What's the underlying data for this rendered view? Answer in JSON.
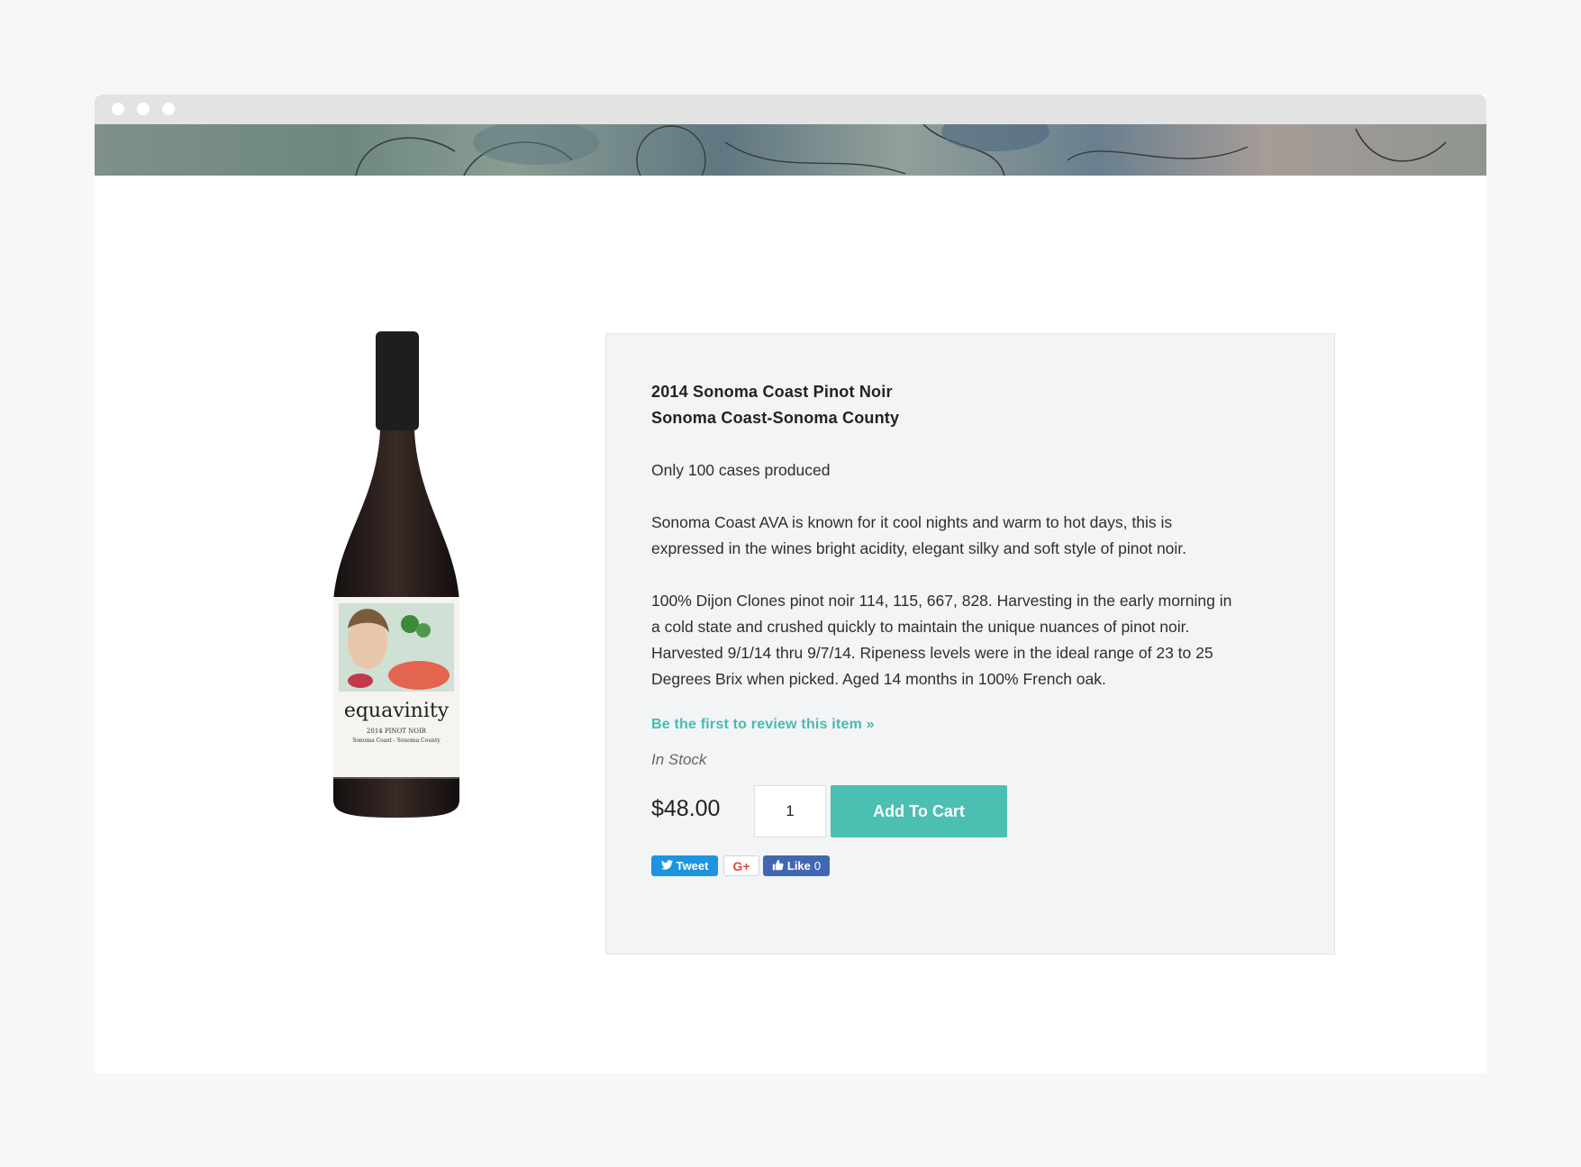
{
  "colors": {
    "accent": "#4bbfb2",
    "link": "#4ab9b0",
    "panel_bg": "#f2f4f6",
    "twitter": "#1b95e0",
    "facebook": "#4267b2",
    "google": "#dd4b39"
  },
  "product": {
    "image_label": {
      "brand": "equavinity",
      "line1": "2014 PINOT NOIR",
      "line2": "Sonoma Coast - Sonoma County"
    },
    "title": "2014 Sonoma Coast Pinot Noir",
    "region": "Sonoma Coast-Sonoma County",
    "cases": "Only 100 cases produced",
    "desc1_line1": "Sonoma Coast AVA is known for it cool nights and warm to hot days, this is",
    "desc1_line2": "expressed in the wines bright acidity, elegant silky and soft style of pinot noir.",
    "desc2_line1": "100% Dijon Clones pinot noir 114, 115, 667, 828.  Harvesting in the early morning in",
    "desc2_line2": "a cold state and crushed quickly to maintain the unique nuances of pinot noir.",
    "desc2_line3": "Harvested 9/1/14 thru 9/7/14. Ripeness levels were in the ideal range of 23 to 25",
    "desc2_line4": "Degrees Brix when picked. Aged 14 months in 100% French oak.",
    "review_link": "Be the first to review this item »",
    "stock": "In Stock",
    "price": "$48.00",
    "quantity": "1",
    "add_to_cart": "Add To Cart"
  },
  "social": {
    "tweet_label": "Tweet",
    "gplus_label": "G+",
    "like_label": "Like",
    "like_count": "0",
    "icons": [
      "twitter-bird-icon",
      "thumbs-up-icon"
    ]
  }
}
